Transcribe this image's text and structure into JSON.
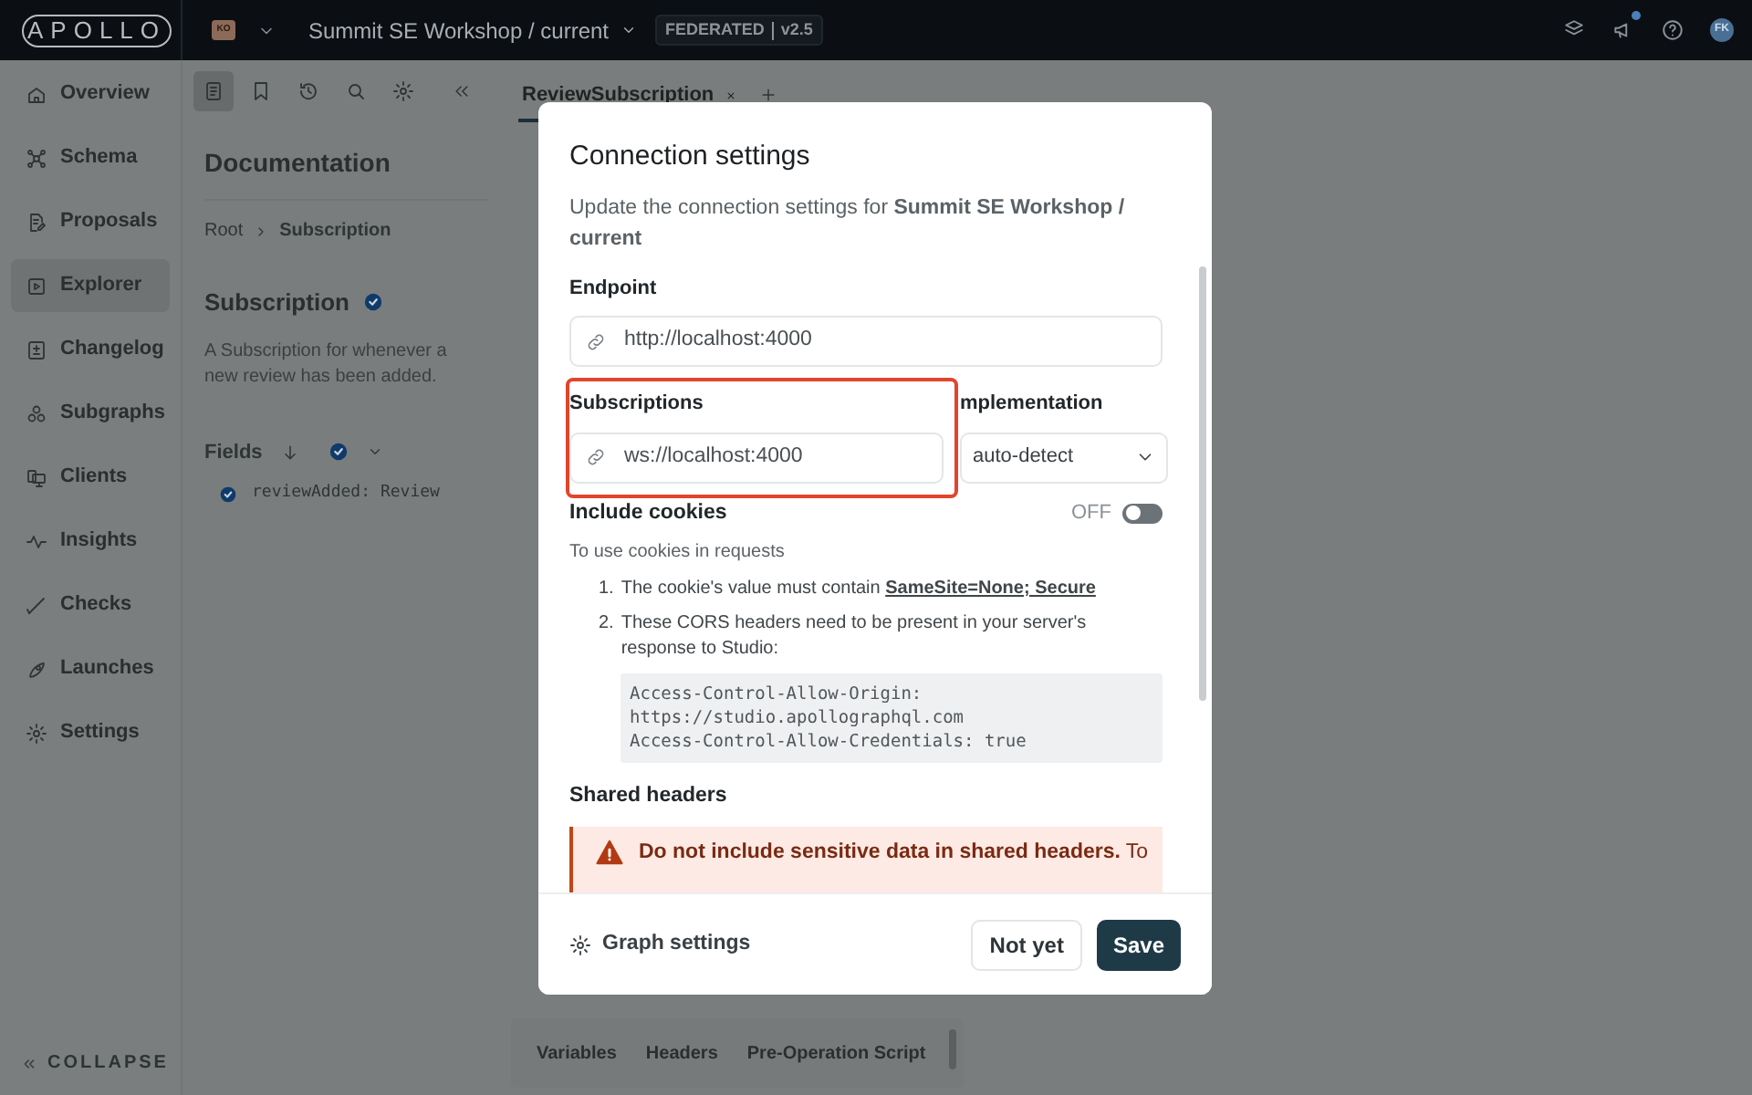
{
  "topbar": {
    "logo": "APOLLO",
    "org_badge": "KO",
    "graph_title": "Summit SE Workshop / current",
    "variant_badge": {
      "type": "FEDERATED",
      "version": "v2.5"
    },
    "notification_unread": true,
    "avatar": "FK"
  },
  "sidebar": {
    "items": [
      {
        "label": "Overview",
        "kind": "overview",
        "selected": false
      },
      {
        "label": "Schema",
        "kind": "schema",
        "selected": false
      },
      {
        "label": "Proposals",
        "kind": "proposals",
        "selected": false
      },
      {
        "label": "Explorer",
        "kind": "explorer",
        "selected": true
      },
      {
        "label": "Changelog",
        "kind": "changelog",
        "selected": false
      },
      {
        "label": "Subgraphs",
        "kind": "subgraphs",
        "selected": false
      },
      {
        "label": "Clients",
        "kind": "clients",
        "selected": false
      },
      {
        "label": "Insights",
        "kind": "insights",
        "selected": false
      },
      {
        "label": "Checks",
        "kind": "checks",
        "selected": false
      },
      {
        "label": "Launches",
        "kind": "launches",
        "selected": false
      },
      {
        "label": "Settings",
        "kind": "settings",
        "selected": false
      }
    ],
    "collapse": "COLLAPSE"
  },
  "toolbar": [
    {
      "kind": "docs",
      "selected": true
    },
    {
      "kind": "bookmark",
      "selected": false
    },
    {
      "kind": "history",
      "selected": false
    },
    {
      "kind": "search",
      "selected": false
    },
    {
      "kind": "settings",
      "selected": false
    }
  ],
  "documentation": {
    "title": "Documentation",
    "breadcrumb": [
      "Root",
      "Subscription"
    ],
    "type_name": "Subscription",
    "description": "A Subscription for whenever a new review has been added.",
    "fields_label": "Fields",
    "fields": [
      {
        "name": "reviewAdded: Review",
        "checked": true
      }
    ]
  },
  "tabs": [
    {
      "label": "ReviewSubscription",
      "selected": true
    }
  ],
  "bottom_tabs": [
    "Variables",
    "Headers",
    "Pre-Operation Script"
  ],
  "modal": {
    "title": "Connection settings",
    "subtitle": "Update the connection settings for **Summit SE Workshop / current**",
    "endpoint": {
      "label": "Endpoint",
      "value": "http://localhost:4000"
    },
    "subscriptions": {
      "label": "Subscriptions",
      "value": "ws://localhost:4000",
      "highlighted": true
    },
    "implementation": {
      "label": "mplementation",
      "value": "auto-detect"
    },
    "cookies": {
      "label": "Include cookies",
      "state_text": "OFF",
      "on": false,
      "help": "To use cookies in requests",
      "steps": [
        {
          "number": "1.",
          "text": "The cookie's value must contain ",
          "link": "SameSite=None; Secure"
        },
        {
          "number": "2.",
          "text": "These CORS headers need to be present in your server's response to Studio:"
        }
      ],
      "code": [
        "Access-Control-Allow-Origin:",
        "https://studio.apollographql.com",
        "Access-Control-Allow-Credentials: true"
      ]
    },
    "shared_headers": {
      "label": "Shared headers",
      "warning": "**Do not include sensitive data in shared headers.** To"
    },
    "footer": {
      "graph_settings": "Graph settings",
      "buttons": [
        "Not yet",
        "Save"
      ]
    }
  }
}
